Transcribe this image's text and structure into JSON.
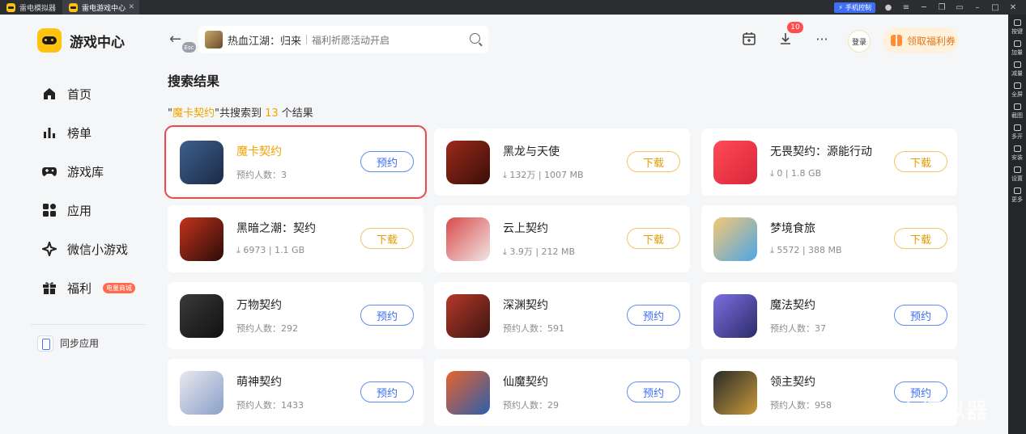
{
  "titlebar": {
    "tabs": [
      {
        "label": "雷电模拟器",
        "active": false
      },
      {
        "label": "雷电游戏中心",
        "active": true
      }
    ],
    "phone_control": "手机控制"
  },
  "right_toolbar": [
    "按键",
    "加量",
    "减量",
    "全屏",
    "截图",
    "多开",
    "安装",
    "设置",
    "更多"
  ],
  "brand": {
    "name": "游戏中心",
    "logo_color": "#ffc20e"
  },
  "nav": [
    {
      "label": "首页",
      "icon": "home-icon"
    },
    {
      "label": "榜单",
      "icon": "chart-icon"
    },
    {
      "label": "游戏库",
      "icon": "gamepad-icon"
    },
    {
      "label": "应用",
      "icon": "apps-icon"
    },
    {
      "label": "微信小游戏",
      "icon": "wechat-minigame-icon"
    },
    {
      "label": "福利",
      "icon": "gift-icon",
      "badge": "电量商城"
    }
  ],
  "sync_apps": "同步应用",
  "header": {
    "esc": "Esc",
    "search_game": "热血江湖：归来",
    "search_hint": "福利祈愿活动开启",
    "download_count": "10",
    "login": "登录",
    "coupon": "领取福利券"
  },
  "results": {
    "title": "搜索结果",
    "summary_prefix": "\"",
    "keyword": "魔卡契约",
    "summary_mid": "\"共搜索到 ",
    "count": "13",
    "summary_suffix": " 个结果"
  },
  "apps": [
    {
      "name": "魔卡契约",
      "meta": "预约人数：3",
      "button": "预约",
      "kind": "reserve",
      "highlight": true,
      "selected": true,
      "colors": [
        "#3d5f8f",
        "#1c2b44"
      ]
    },
    {
      "name": "黑龙与天使",
      "meta": "⤓ 132万 | 1007 MB",
      "button": "下载",
      "kind": "download",
      "colors": [
        "#9b2a1a",
        "#3a0e08"
      ]
    },
    {
      "name": "无畏契约：源能行动",
      "meta": "⤓ 0 | 1.8 GB",
      "button": "下载",
      "kind": "download",
      "colors": [
        "#ff4b55",
        "#d9263b"
      ]
    },
    {
      "name": "黑暗之潮：契约",
      "meta": "⤓ 6973 | 1.1 GB",
      "button": "下载",
      "kind": "download",
      "colors": [
        "#c4321c",
        "#2a0d08"
      ]
    },
    {
      "name": "云上契约",
      "meta": "⤓ 3.9万 | 212 MB",
      "button": "下载",
      "kind": "download",
      "colors": [
        "#d84a4a",
        "#f1e6e6"
      ]
    },
    {
      "name": "梦境食旅",
      "meta": "⤓ 5572 | 388 MB",
      "button": "下载",
      "kind": "download",
      "colors": [
        "#f7c873",
        "#4aa6e8"
      ]
    },
    {
      "name": "万物契约",
      "meta": "预约人数：292",
      "button": "预约",
      "kind": "reserve",
      "colors": [
        "#3a3a3a",
        "#111111"
      ]
    },
    {
      "name": "深渊契约",
      "meta": "预约人数：591",
      "button": "预约",
      "kind": "reserve",
      "colors": [
        "#b6382a",
        "#3b1510"
      ]
    },
    {
      "name": "魔法契约",
      "meta": "预约人数：37",
      "button": "预约",
      "kind": "reserve",
      "colors": [
        "#7b6fe0",
        "#2b2b6a"
      ]
    },
    {
      "name": "萌神契约",
      "meta": "预约人数：1433",
      "button": "预约",
      "kind": "reserve",
      "colors": [
        "#e8e8ee",
        "#8aa0c8"
      ]
    },
    {
      "name": "仙魔契约",
      "meta": "预约人数：29",
      "button": "预约",
      "kind": "reserve",
      "colors": [
        "#e8622a",
        "#2b5fb0"
      ]
    },
    {
      "name": "领主契约",
      "meta": "预约人数：958",
      "button": "预约",
      "kind": "reserve",
      "colors": [
        "#2a2a2a",
        "#c79a3a"
      ]
    }
  ],
  "watermark": "雷电模拟器"
}
